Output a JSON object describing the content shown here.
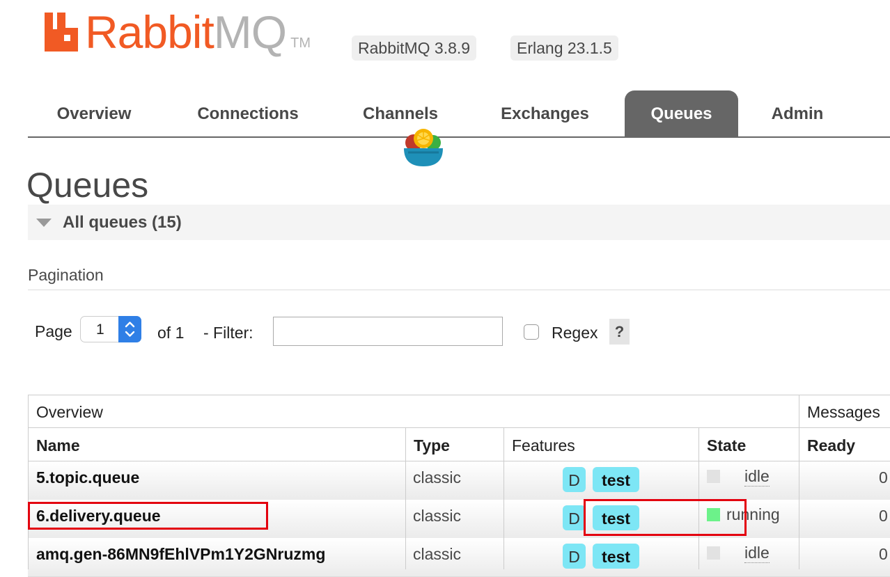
{
  "header": {
    "logo_primary": "Rabbit",
    "logo_secondary": "MQ",
    "logo_tm": "TM",
    "rabbitmq_version": "RabbitMQ 3.8.9",
    "erlang_version": "Erlang 23.1.5"
  },
  "nav": {
    "tabs": [
      {
        "label": "Overview",
        "active": false
      },
      {
        "label": "Connections",
        "active": false
      },
      {
        "label": "Channels",
        "active": false
      },
      {
        "label": "Exchanges",
        "active": false
      },
      {
        "label": "Queues",
        "active": true
      },
      {
        "label": "Admin",
        "active": false
      }
    ]
  },
  "page": {
    "title": "Queues",
    "section_title": "All queues (15)"
  },
  "pagination": {
    "section_label": "Pagination",
    "page_label": "Page",
    "page_value": "1",
    "of_label": "of 1",
    "filter_label": "- Filter:",
    "filter_value": "",
    "regex_label": "Regex",
    "regex_checked": false,
    "help_label": "?"
  },
  "table": {
    "group_headers": {
      "overview": "Overview",
      "messages": "Messages"
    },
    "columns": {
      "name": "Name",
      "type": "Type",
      "features": "Features",
      "state": "State",
      "ready": "Ready"
    },
    "rows": [
      {
        "name": "5.topic.queue",
        "type": "classic",
        "feature_d": "D",
        "feature_args": "test",
        "state": "idle",
        "ready": "0"
      },
      {
        "name": "6.delivery.queue",
        "type": "classic",
        "feature_d": "D",
        "feature_args": "test",
        "state": "running",
        "ready": "0"
      },
      {
        "name": "amq.gen-86MN9fEhlVPm1Y2GNruzmg",
        "type": "classic",
        "feature_d": "D",
        "feature_args": "test",
        "state": "idle",
        "ready": "0"
      }
    ]
  },
  "colors": {
    "brand_orange": "#f15a24",
    "active_tab": "#666666",
    "badge": "#7de6f5",
    "running": "#6cf28a",
    "idle": "#e2e2e2",
    "highlight": "#e3000f"
  }
}
